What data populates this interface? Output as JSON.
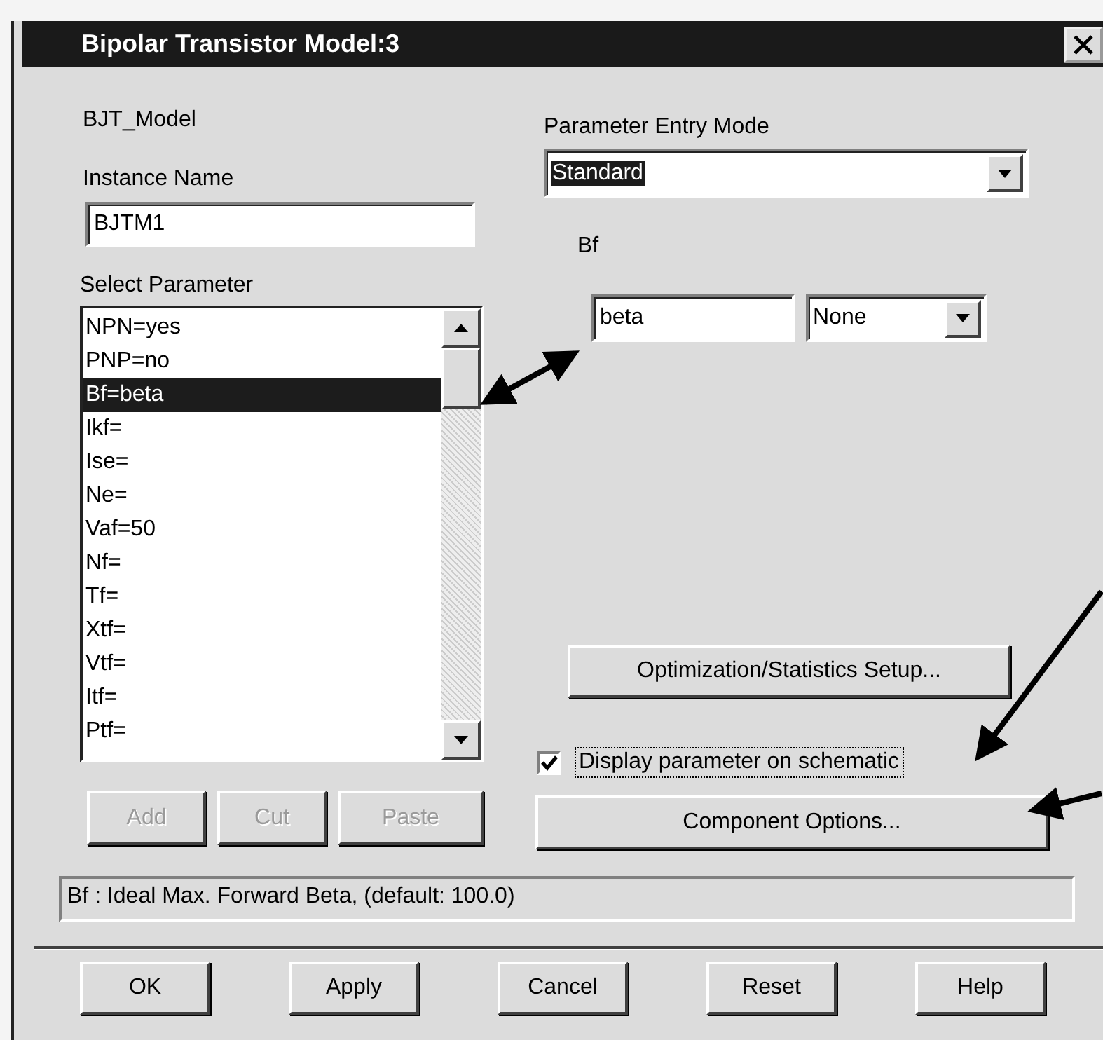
{
  "window": {
    "title": "Bipolar Transistor Model:3"
  },
  "model_name": "BJT_Model",
  "instance_name": {
    "label": "Instance Name",
    "value": "BJTM1"
  },
  "select_parameter": {
    "label": "Select Parameter",
    "items": [
      {
        "text": "NPN=yes",
        "selected": false
      },
      {
        "text": "PNP=no",
        "selected": false
      },
      {
        "text": "Bf=beta",
        "selected": true
      },
      {
        "text": "Ikf=",
        "selected": false
      },
      {
        "text": "Ise=",
        "selected": false
      },
      {
        "text": "Ne=",
        "selected": false
      },
      {
        "text": "Vaf=50",
        "selected": false
      },
      {
        "text": "Nf=",
        "selected": false
      },
      {
        "text": "Tf=",
        "selected": false
      },
      {
        "text": "Xtf=",
        "selected": false
      },
      {
        "text": "Vtf=",
        "selected": false
      },
      {
        "text": "Itf=",
        "selected": false
      },
      {
        "text": "Ptf=",
        "selected": false
      }
    ]
  },
  "list_buttons": [
    {
      "label": "Add",
      "disabled": true
    },
    {
      "label": "Cut",
      "disabled": true
    },
    {
      "label": "Paste",
      "disabled": true
    }
  ],
  "parameter_entry_mode": {
    "label": "Parameter Entry Mode",
    "value": "Standard"
  },
  "parameter": {
    "label": "Bf",
    "value": "beta",
    "unit": "None"
  },
  "optimization_button": "Optimization/Statistics Setup...",
  "display_on_schematic": {
    "label": "Display parameter on schematic",
    "checked": true
  },
  "component_options_button": "Component Options...",
  "status_text": "Bf : Ideal Max. Forward Beta, (default: 100.0)",
  "buttons": [
    "OK",
    "Apply",
    "Cancel",
    "Reset",
    "Help"
  ]
}
